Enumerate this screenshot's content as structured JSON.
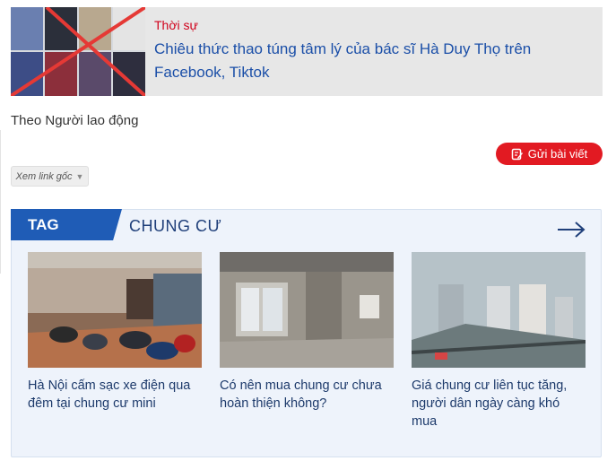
{
  "related": {
    "category": "Thời sự",
    "title": "Chiêu thức thao túng tâm lý của bác sĩ Hà Duy Thọ trên Facebook, Tiktok"
  },
  "source": "Theo Người lao động",
  "submit_button": {
    "label": "Gửi bài viết",
    "icon": "pencil-square-icon"
  },
  "link_button": {
    "label": "Xem link gốc",
    "icon": "chevron-down-icon"
  },
  "tag_section": {
    "badge": "TAG",
    "name": "CHUNG CƯ",
    "arrow_icon": "arrow-right-icon",
    "cards": [
      {
        "title": "Hà Nội cấm sạc xe điện qua đêm tại chung cư mini"
      },
      {
        "title": "Có nên mua chung cư chưa hoàn thiện không?"
      },
      {
        "title": "Giá chung cư liên tục tăng, người dân ngày càng khó mua"
      }
    ]
  },
  "colors": {
    "accent_red": "#e21a22",
    "link_blue": "#1b4fa8",
    "tag_blue": "#1f5cb6"
  }
}
